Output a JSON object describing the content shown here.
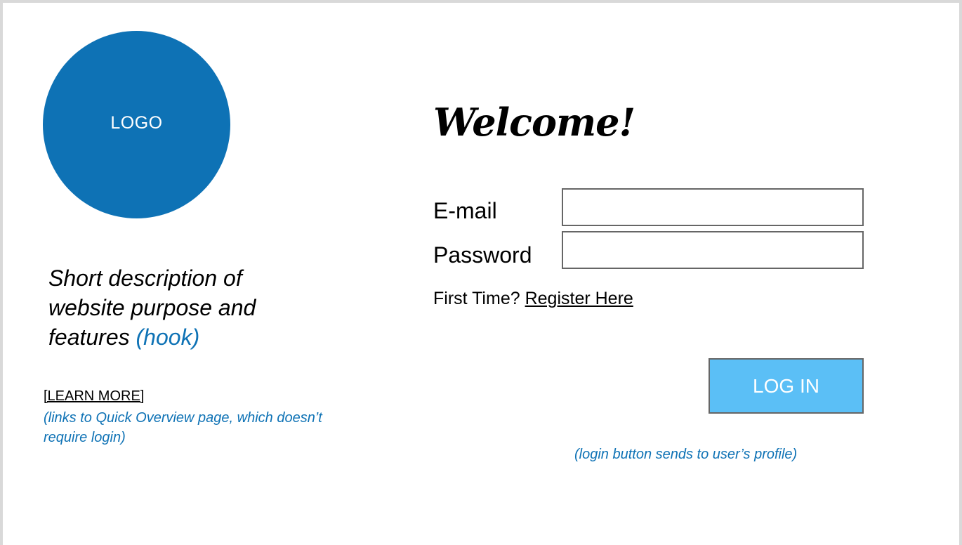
{
  "logo": {
    "text": "LOGO"
  },
  "description": {
    "text": "Short description of website purpose and features",
    "hook": "(hook)"
  },
  "learn_more": {
    "label": "[LEARN MORE]",
    "note": "(links to Quick Overview page, which doesn’t require login)"
  },
  "welcome": "Welcome!",
  "form": {
    "email_label": "E-mail",
    "email_value": "",
    "password_label": "Password",
    "password_value": "",
    "first_time": "First Time?",
    "register_link": "Register Here",
    "login_button": "LOG IN",
    "login_note": "(login button sends to user’s profile)"
  },
  "colors": {
    "brand_blue": "#0e72b5",
    "button_blue": "#5bbff6",
    "frame_gray": "#d9d9d9",
    "field_border": "#666666"
  }
}
